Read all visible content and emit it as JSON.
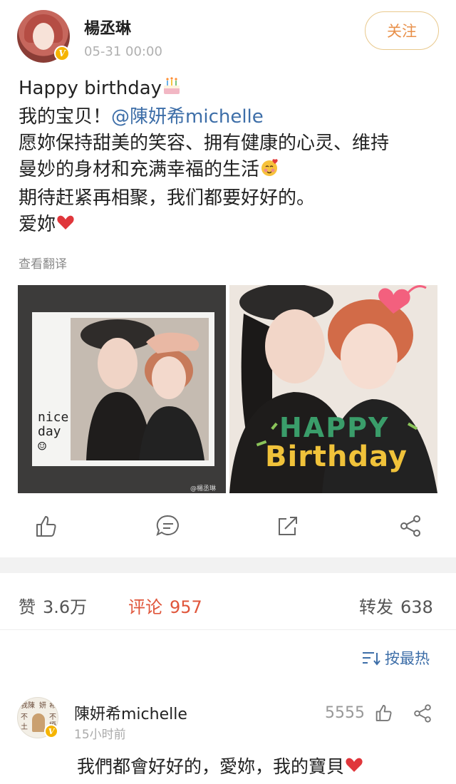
{
  "post": {
    "author": "楊丞琳",
    "timestamp": "05-31 00:00",
    "follow_label": "关注",
    "lines": {
      "l1": "Happy birthday",
      "l2_prefix": "我的宝贝！",
      "l2_mention": "@陳妍希michelle",
      "l3": "愿妳保持甜美的笑容、拥有健康的心灵、维持",
      "l4": "曼妙的身材和充满幸福的生活",
      "l5": "期待赶紧再相聚，我们都要好好的。",
      "l6": "爱妳"
    },
    "translate_label": "查看翻译",
    "photo1_text": {
      "nice": "nice",
      "day": "day",
      "smile": "☺",
      "watermark": "@楊丞琳"
    },
    "photo2_text": {
      "happy": "HAPPY",
      "birthday": "Birthday"
    }
  },
  "actions": {
    "like_icon": "thumbs-up-icon",
    "comment_icon": "comment-icon",
    "repost_icon": "repost-icon",
    "share_icon": "share-icon"
  },
  "stats": {
    "likes_label": "赞",
    "likes_value": "3.6万",
    "comments_label": "评论",
    "comments_value": "957",
    "reposts_label": "转发",
    "reposts_value": "638"
  },
  "sort": {
    "label": "按最热",
    "icon": "sort-icon"
  },
  "comment": {
    "author": "陳妍希michelle",
    "time": "15小时前",
    "likes": "5555",
    "text": "我們都會好好的，愛妳，我的寶貝",
    "avatar_text": [
      "我陳",
      "妍",
      "希",
      "不",
      "不",
      "擾",
      "土"
    ]
  },
  "colors": {
    "accent_orange": "#e8904a",
    "link_blue": "#3d6ea8",
    "active_red": "#e0563b",
    "verify_gold": "#f5b400"
  }
}
